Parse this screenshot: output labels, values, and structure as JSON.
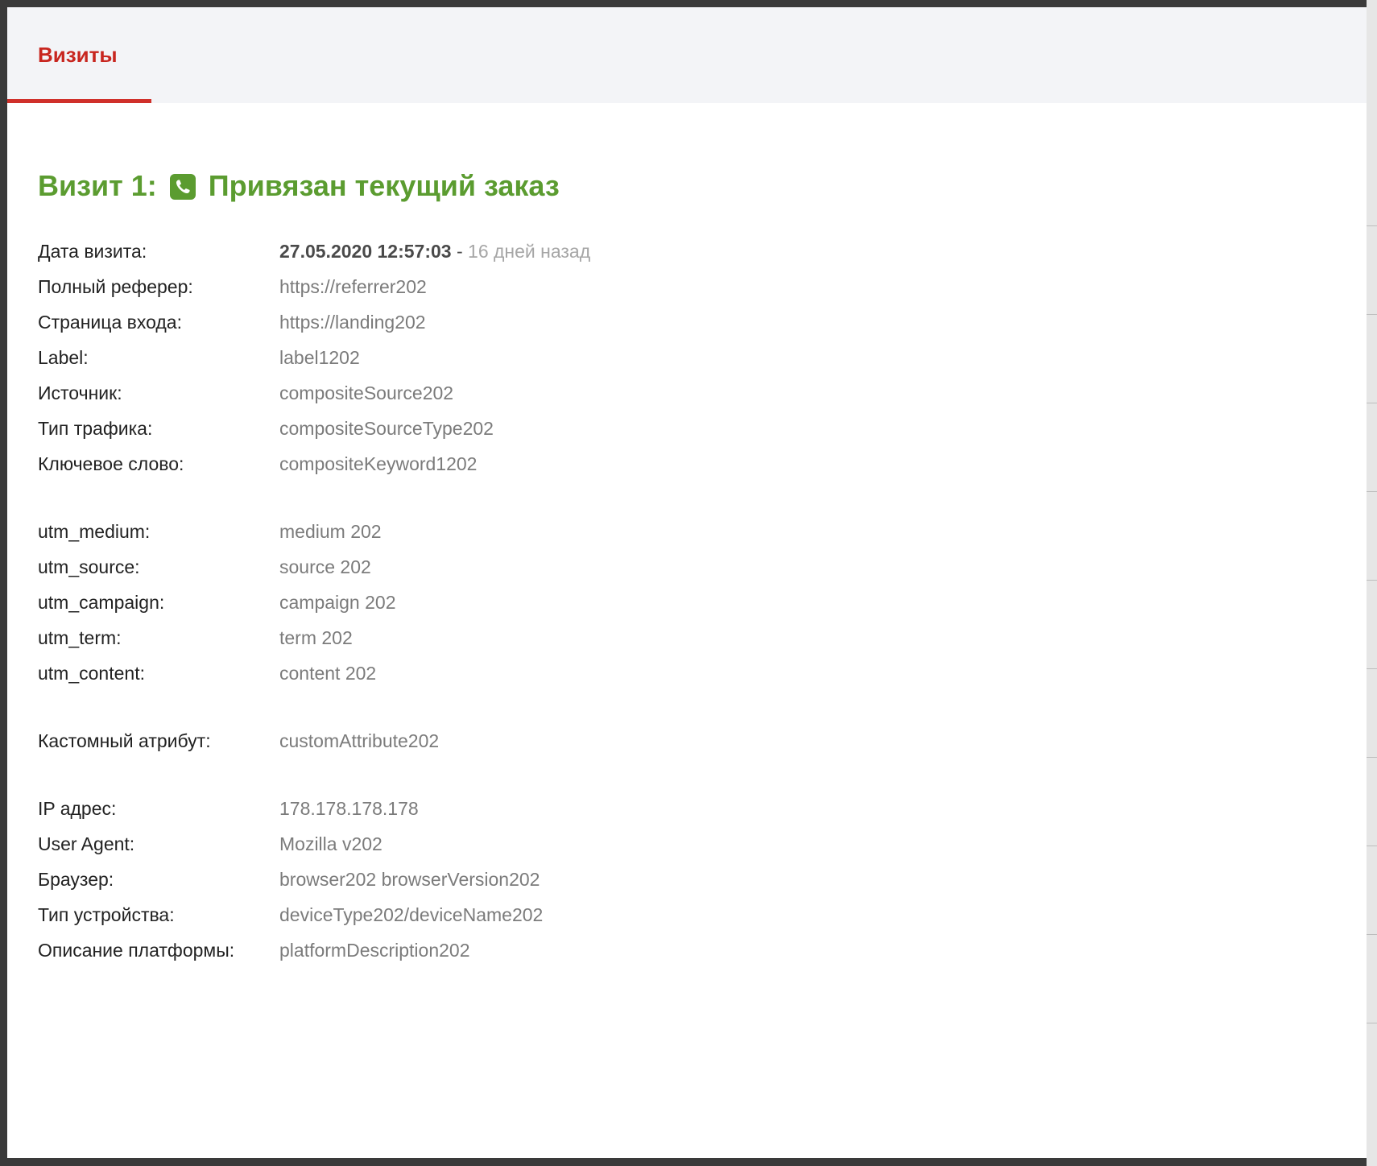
{
  "tabs": [
    {
      "label": "Визиты",
      "active": true
    }
  ],
  "colors": {
    "accent_red": "#c8261f",
    "title_green": "#5b9c30"
  },
  "visit": {
    "title": "Визит 1:",
    "icon": "phone-icon",
    "status": "Привязан текущий заказ",
    "date": {
      "label": "Дата визита:",
      "value": "27.05.2020 12:57:03",
      "separator": " - ",
      "relative": "16 дней назад"
    },
    "group_main": [
      {
        "label": "Полный реферер:",
        "value": "https://referrer202"
      },
      {
        "label": "Страница входа:",
        "value": "https://landing202"
      },
      {
        "label": "Label:",
        "value": "label1202"
      },
      {
        "label": "Источник:",
        "value": "compositeSource202"
      },
      {
        "label": "Тип трафика:",
        "value": "compositeSourceType202"
      },
      {
        "label": "Ключевое слово:",
        "value": "compositeKeyword1202"
      }
    ],
    "group_utm": [
      {
        "label": "utm_medium:",
        "value": "medium 202"
      },
      {
        "label": "utm_source:",
        "value": "source 202"
      },
      {
        "label": "utm_campaign:",
        "value": "campaign 202"
      },
      {
        "label": "utm_term:",
        "value": "term 202"
      },
      {
        "label": "utm_content:",
        "value": "content 202"
      }
    ],
    "group_custom": [
      {
        "label": "Кастомный атрибут:",
        "value": "customAttribute202"
      }
    ],
    "group_device": [
      {
        "label": "IP адрес:",
        "value": "178.178.178.178"
      },
      {
        "label": "User Agent:",
        "value": "Mozilla v202"
      },
      {
        "label": "Браузер:",
        "value": "browser202 browserVersion202"
      },
      {
        "label": "Тип устройства:",
        "value": "deviceType202/deviceName202"
      },
      {
        "label": "Описание платформы:",
        "value": "platformDescription202"
      }
    ]
  }
}
